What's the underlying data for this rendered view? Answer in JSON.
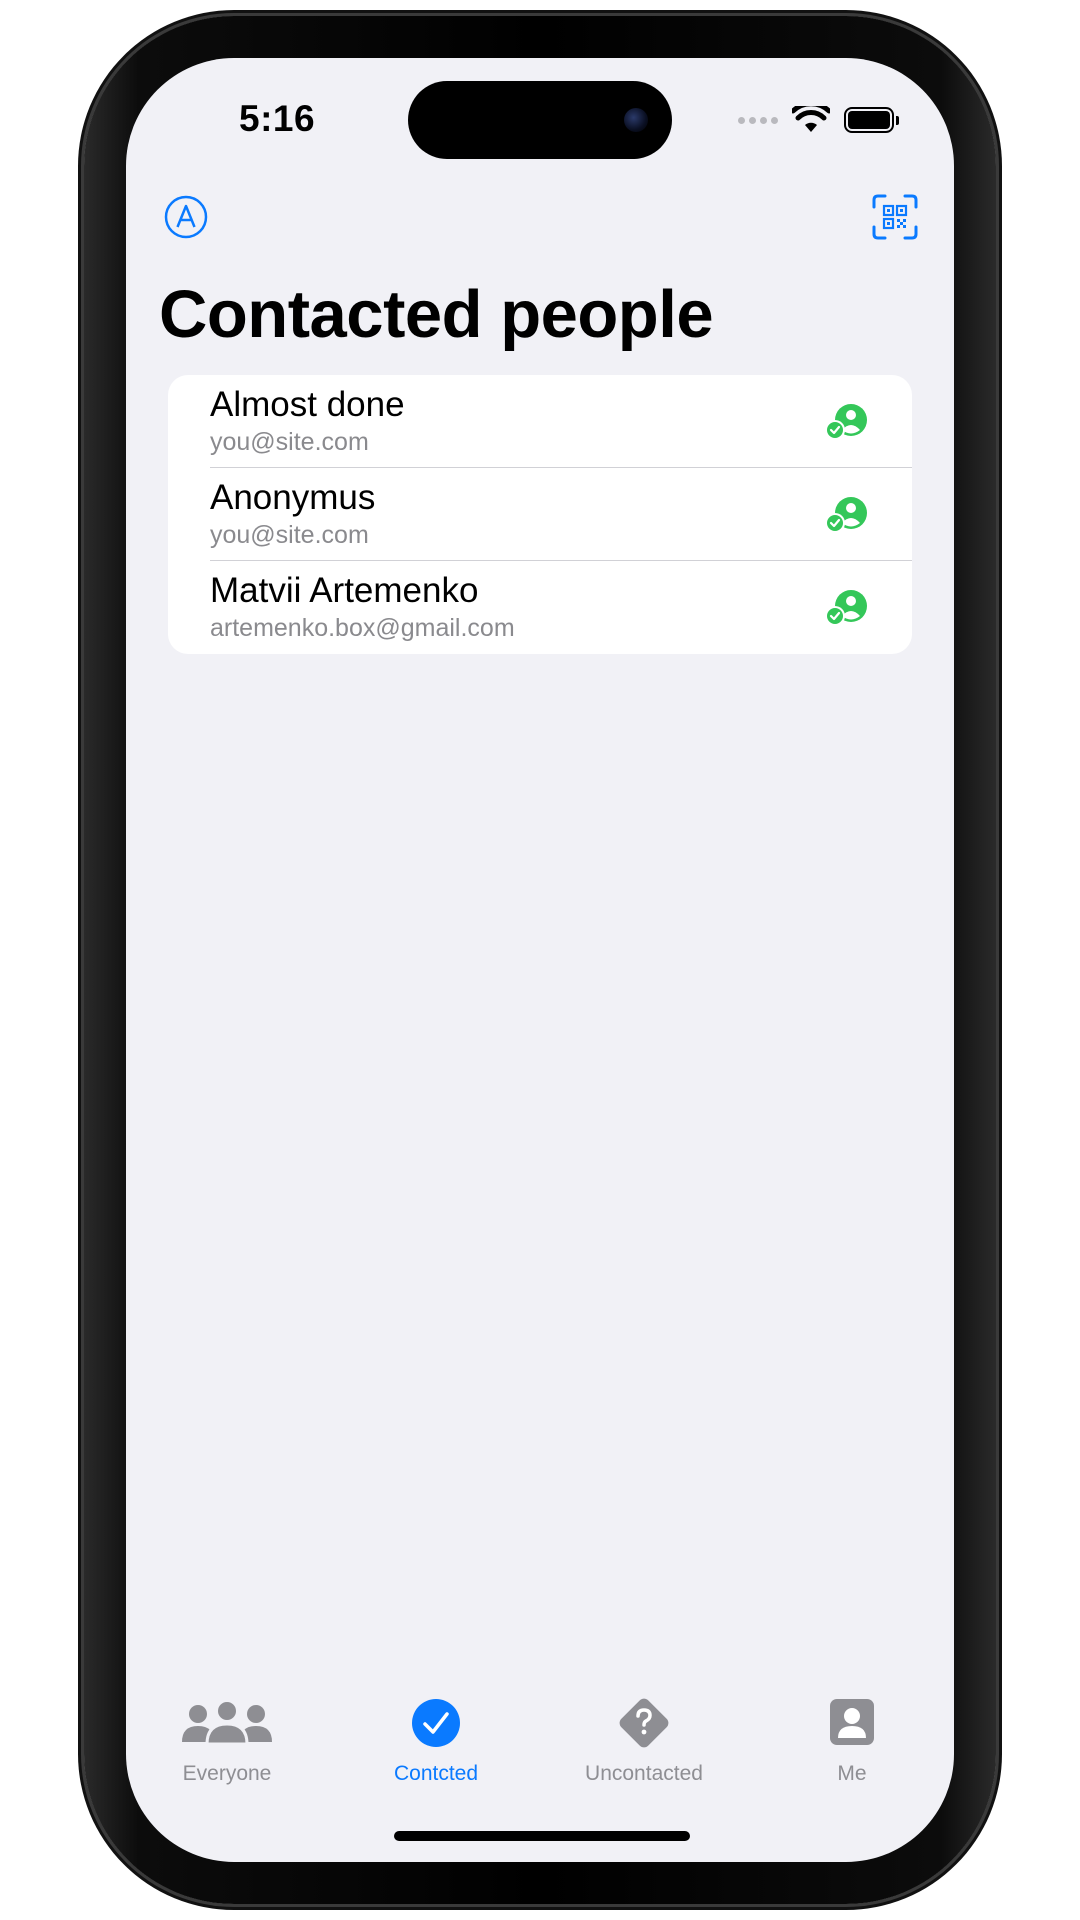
{
  "status_bar": {
    "time": "5:16"
  },
  "nav": {
    "left_icon": "a-circle-icon",
    "right_icon": "qr-scan-icon",
    "title": "Contacted people"
  },
  "contacts": [
    {
      "name": "Almost done",
      "email": "you@site.com",
      "status_icon": "person-checkmark-icon"
    },
    {
      "name": "Anonymus",
      "email": "you@site.com",
      "status_icon": "person-checkmark-icon"
    },
    {
      "name": "Matvii Artemenko",
      "email": "artemenko.box@gmail.com",
      "status_icon": "person-checkmark-icon"
    }
  ],
  "tabs": [
    {
      "label": "Everyone",
      "icon": "people-icon",
      "active": false
    },
    {
      "label": "Contcted",
      "icon": "checkmark-circle-icon",
      "active": true
    },
    {
      "label": "Uncontacted",
      "icon": "questionmark-diamond-icon",
      "active": false
    },
    {
      "label": "Me",
      "icon": "person-square-icon",
      "active": false
    }
  ],
  "colors": {
    "accent": "#0a7aff",
    "contacted_green": "#34c759",
    "tab_inactive": "#8e8e93",
    "background": "#f1f1f6"
  }
}
